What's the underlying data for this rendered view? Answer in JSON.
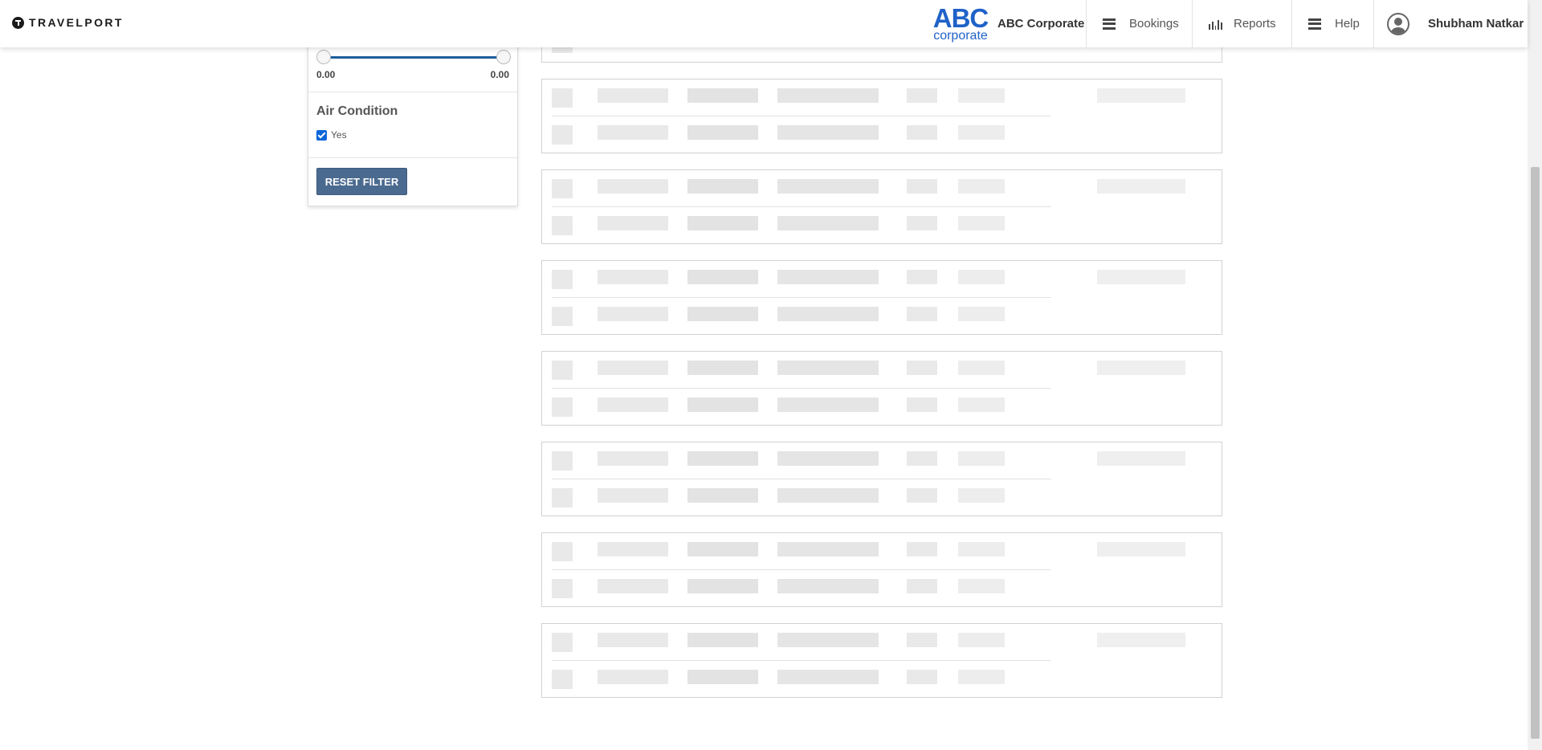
{
  "header": {
    "logo_text": "TRAVELPORT",
    "brand_abc": "ABC",
    "brand_sub": "corporate",
    "company_name": "ABC Corporate",
    "nav": {
      "bookings": "Bookings",
      "reports": "Reports",
      "help": "Help"
    },
    "user_name": "Shubham Natkar"
  },
  "filters": {
    "slider": {
      "min_label": "0.00",
      "max_label": "0.00"
    },
    "air_condition": {
      "title": "Air Condition",
      "option_label": "Yes",
      "checked": true
    },
    "reset_label": "RESET FILTER"
  },
  "results": {
    "state": "loading",
    "skeleton_card_count": 8
  },
  "colors": {
    "brand_blue": "#1f62c8",
    "slider_blue": "#1e5d9c",
    "reset_button": "#4b6a8f",
    "checkbox": "#0a66d8",
    "skeleton": "#e9e9e9"
  }
}
